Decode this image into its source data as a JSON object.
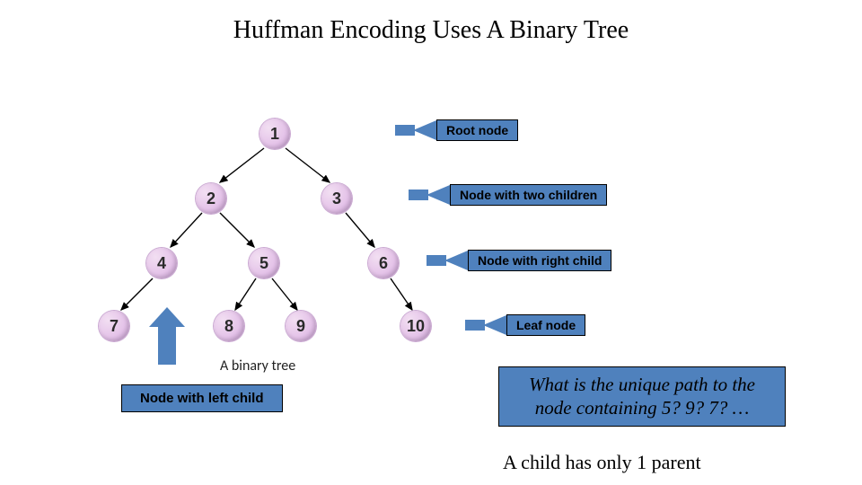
{
  "title": "Huffman Encoding Uses A Binary Tree",
  "tree": {
    "nodes": {
      "n1": "1",
      "n2": "2",
      "n3": "3",
      "n4": "4",
      "n5": "5",
      "n6": "6",
      "n7": "7",
      "n8": "8",
      "n9": "9",
      "n10": "10"
    },
    "caption": "A binary tree"
  },
  "callouts": {
    "root": "Root node",
    "two_children": "Node with two children",
    "right_child": "Node with right child",
    "leaf": "Leaf node"
  },
  "left_child_label": "Node with left child",
  "question_box": "What is the unique path to the node containing 5? 9? 7? …",
  "footnote": "A child has only 1 parent"
}
